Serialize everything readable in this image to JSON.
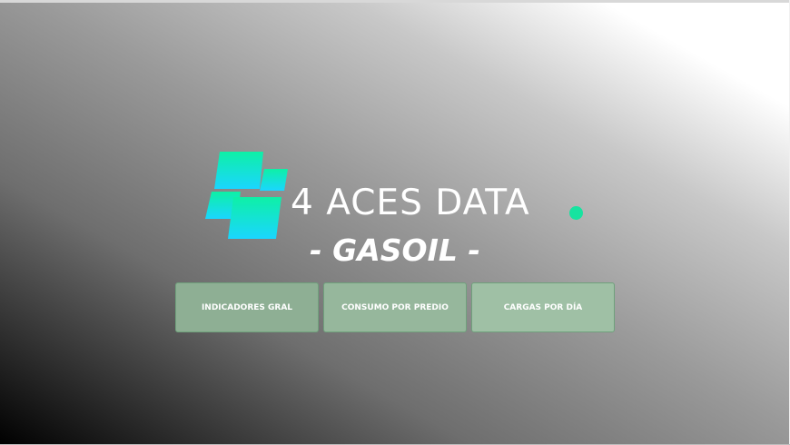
{
  "brand": {
    "name": "4 ACES DATA",
    "logo_icon": "four-tiles-logo-icon",
    "accent_color": "#17e3a0",
    "gradient_colors": [
      "#0ef0a6",
      "#1ad6ff"
    ]
  },
  "page": {
    "subtitle": "- GASOIL -"
  },
  "nav": {
    "buttons": [
      {
        "label": "INDICADORES GRAL"
      },
      {
        "label": "CONSUMO POR PREDIO"
      },
      {
        "label": "CARGAS POR DÍA"
      }
    ]
  }
}
